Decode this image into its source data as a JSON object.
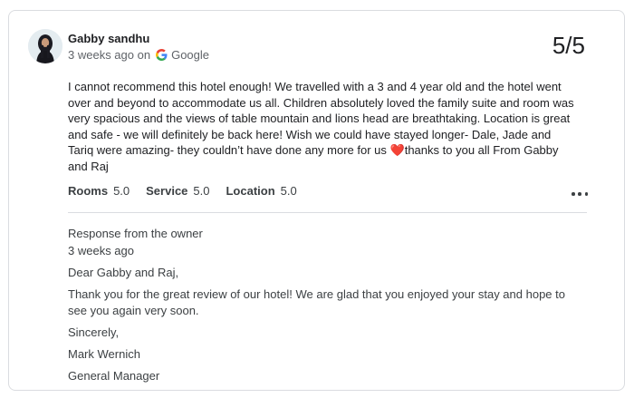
{
  "review": {
    "reviewer_name": "Gabby sandhu",
    "time_ago": "3 weeks ago on",
    "source": "Google",
    "rating": "5/5",
    "text": "I cannot recommend this hotel enough! We travelled with a 3 and 4 year old and the hotel went over and beyond to accommodate us all. Children absolutely loved the family suite and room was very spacious and the views of table mountain and lions head are breathtaking. Location is great and safe - we will definitely be back here! Wish we could have stayed longer- Dale, Jade and Tariq were amazing- they couldn’t have done any more for us ",
    "text_end": "thanks to you all From Gabby and Raj",
    "emoji": "❤️",
    "subratings": [
      {
        "label": "Rooms",
        "value": "5.0"
      },
      {
        "label": "Service",
        "value": "5.0"
      },
      {
        "label": "Location",
        "value": "5.0"
      }
    ]
  },
  "owner_response": {
    "title": "Response from the owner",
    "time_ago": "3 weeks ago",
    "greeting": "Dear Gabby and Raj,",
    "body": "Thank you for the great review of our hotel! We are glad that you enjoyed your stay and hope to see you again very soon.",
    "closing": "Sincerely,",
    "signer_name": "Mark Wernich",
    "signer_title": "General Manager"
  },
  "icons": {
    "source_logo": "google-g-icon",
    "more": "more-horizontal-icon"
  },
  "colors": {
    "google_blue": "#4285F4",
    "google_red": "#EA4335",
    "google_yellow": "#FBBC05",
    "google_green": "#34A853",
    "heart": "#e0245e"
  }
}
